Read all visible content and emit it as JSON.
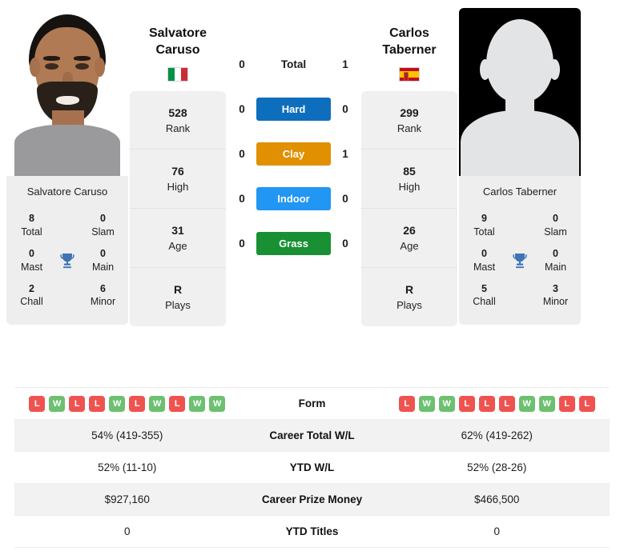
{
  "players": {
    "left": {
      "first_name": "Salvatore",
      "last_name": "Caruso",
      "full_name": "Salvatore Caruso",
      "photo_caption": "Salvatore Caruso",
      "country": "Italy",
      "flag_icon": "flag-italy-icon",
      "stats": [
        {
          "value": "528",
          "label": "Rank"
        },
        {
          "value": "76",
          "label": "High"
        },
        {
          "value": "31",
          "label": "Age"
        },
        {
          "value": "R",
          "label": "Plays"
        }
      ],
      "titles": {
        "total": "8",
        "slam": "0",
        "mast": "0",
        "main": "0",
        "chall": "2",
        "minor": "6"
      },
      "form": [
        "L",
        "W",
        "L",
        "L",
        "W",
        "L",
        "W",
        "L",
        "W",
        "W"
      ],
      "career_total_wl": "54% (419-355)",
      "ytd_wl": "52% (11-10)",
      "career_prize_money": "$927,160",
      "ytd_titles": "0"
    },
    "right": {
      "first_name": "Carlos",
      "last_name": "Taberner",
      "full_name": "Carlos Taberner",
      "photo_caption": "Carlos Taberner",
      "country": "Spain",
      "flag_icon": "flag-spain-icon",
      "stats": [
        {
          "value": "299",
          "label": "Rank"
        },
        {
          "value": "85",
          "label": "High"
        },
        {
          "value": "26",
          "label": "Age"
        },
        {
          "value": "R",
          "label": "Plays"
        }
      ],
      "titles": {
        "total": "9",
        "slam": "0",
        "mast": "0",
        "main": "0",
        "chall": "5",
        "minor": "3"
      },
      "form": [
        "L",
        "W",
        "W",
        "L",
        "L",
        "L",
        "W",
        "W",
        "L",
        "L"
      ],
      "career_total_wl": "62% (419-262)",
      "ytd_wl": "52% (28-26)",
      "career_prize_money": "$466,500",
      "ytd_titles": "0"
    }
  },
  "titles_labels": {
    "total": "Total",
    "slam": "Slam",
    "mast": "Mast",
    "main": "Main",
    "chall": "Chall",
    "minor": "Minor",
    "trophy_icon": "trophy-icon"
  },
  "head_to_head": [
    {
      "label": "Total",
      "left": "0",
      "right": "1",
      "style": "plain",
      "color": ""
    },
    {
      "label": "Hard",
      "left": "0",
      "right": "0",
      "style": "pill",
      "color": "#0d6ebd"
    },
    {
      "label": "Clay",
      "left": "0",
      "right": "1",
      "style": "pill",
      "color": "#e09000"
    },
    {
      "label": "Indoor",
      "left": "0",
      "right": "0",
      "style": "pill",
      "color": "#2196f3"
    },
    {
      "label": "Grass",
      "left": "0",
      "right": "0",
      "style": "pill",
      "color": "#189033"
    }
  ],
  "table_rows": [
    {
      "label": "Form",
      "key": "form",
      "type": "form"
    },
    {
      "label": "Career Total W/L",
      "key": "career_total_wl",
      "type": "text"
    },
    {
      "label": "YTD W/L",
      "key": "ytd_wl",
      "type": "text"
    },
    {
      "label": "Career Prize Money",
      "key": "career_prize_money",
      "type": "text"
    },
    {
      "label": "YTD Titles",
      "key": "ytd_titles",
      "type": "text"
    }
  ],
  "colors": {
    "win_badge": "#6cc070",
    "loss_badge": "#ef5350",
    "card_bg": "#f0f0f0",
    "row_alt_bg": "#f2f2f2"
  }
}
